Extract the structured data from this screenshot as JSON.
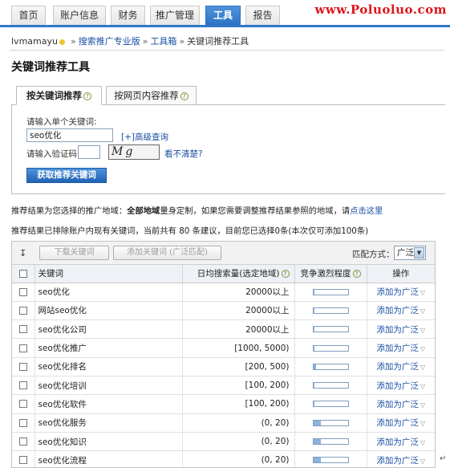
{
  "nav": {
    "tabs": [
      {
        "label": "首页",
        "active": false
      },
      {
        "label": "账户信息",
        "active": false
      },
      {
        "label": "财务",
        "active": false
      },
      {
        "label": "推广管理",
        "active": false
      },
      {
        "label": "工具",
        "active": true
      },
      {
        "label": "报告",
        "active": false
      }
    ],
    "watermark": "www.Poluoluo.com"
  },
  "breadcrumb": {
    "user": "lvmamayu",
    "sep": "»",
    "items": [
      "搜索推广专业版",
      "工具箱",
      "关键词推荐工具"
    ]
  },
  "page_title": "关键词推荐工具",
  "subtabs": [
    {
      "label": "按关键词推荐",
      "active": true
    },
    {
      "label": "按网页内容推荐",
      "active": false
    }
  ],
  "form": {
    "keyword_label": "请输入单个关键词:",
    "keyword_value": "seo优化",
    "advanced_link": "[+]高级查询",
    "captcha_label": "请输入验证码:",
    "captcha_value": "",
    "captcha_image_text": "Mg cd",
    "unclear_link": "看不清楚?",
    "submit_button": "获取推荐关键词"
  },
  "info": {
    "line1_pre": "推荐结果为您选择的推广地域：",
    "line1_bold": "全部地域",
    "line1_mid": "量身定制，如果您需要调整推荐结果参照的地域，请",
    "line1_link": "点击这里",
    "line2": "推荐结果已排除账户内现有关键词，当前共有 80 条建议，目前您已选择0条(本次仅可添加100条)"
  },
  "toolbar": {
    "sort_icon": "↧",
    "download_button": "下载关键词",
    "add_button": "添加关键词 (广泛匹配)",
    "match_label": "匹配方式：",
    "match_value": "广泛"
  },
  "table": {
    "headers": {
      "keyword": "关键词",
      "search_volume": "日均搜索量(选定地域)",
      "competition": "竞争激烈程度",
      "action": "操作"
    },
    "rows": [
      {
        "keyword": "seo优化",
        "volume": "20000以上",
        "competition": 0.02,
        "action": "添加为广泛"
      },
      {
        "keyword": "网站seo优化",
        "volume": "20000以上",
        "competition": 0.02,
        "action": "添加为广泛"
      },
      {
        "keyword": "seo优化公司",
        "volume": "20000以上",
        "competition": 0.02,
        "action": "添加为广泛"
      },
      {
        "keyword": "seo优化推广",
        "volume": "[1000, 5000)",
        "competition": 0.02,
        "action": "添加为广泛"
      },
      {
        "keyword": "seo优化排名",
        "volume": "[200, 500)",
        "competition": 0.08,
        "action": "添加为广泛"
      },
      {
        "keyword": "seo优化培训",
        "volume": "[100, 200)",
        "competition": 0.02,
        "action": "添加为广泛"
      },
      {
        "keyword": "seo优化软件",
        "volume": "[100, 200)",
        "competition": 0.02,
        "action": "添加为广泛"
      },
      {
        "keyword": "seo优化服务",
        "volume": "(0, 20)",
        "competition": 0.22,
        "action": "添加为广泛"
      },
      {
        "keyword": "seo优化知识",
        "volume": "(0, 20)",
        "competition": 0.22,
        "action": "添加为广泛"
      },
      {
        "keyword": "seo优化流程",
        "volume": "(0, 20)",
        "competition": 0.22,
        "action": "添加为广泛"
      }
    ]
  }
}
